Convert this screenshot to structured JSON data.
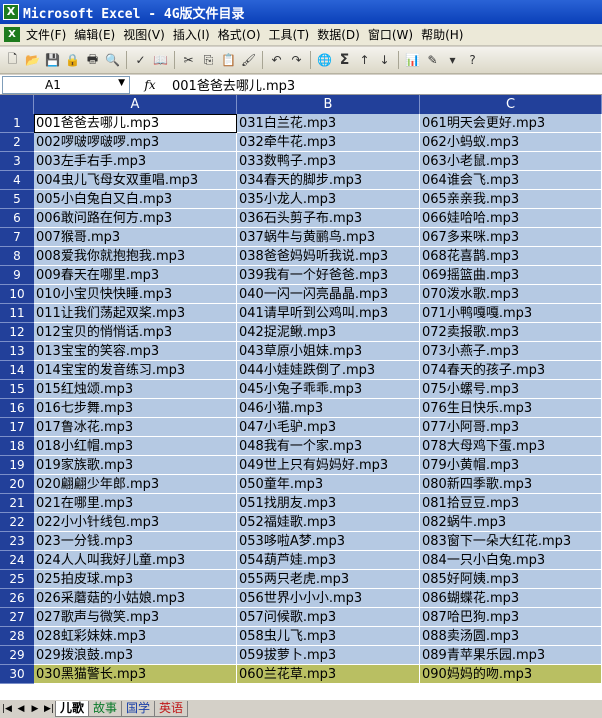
{
  "window": {
    "title": "Microsoft Excel - 4G版文件目录",
    "app_icon": "X"
  },
  "menu": [
    "文件(F)",
    "编辑(E)",
    "视图(V)",
    "插入(I)",
    "格式(O)",
    "工具(T)",
    "数据(D)",
    "窗口(W)",
    "帮助(H)"
  ],
  "toolbar": {
    "sum_symbol": "Σ",
    "zoom": "▾"
  },
  "formula_bar": {
    "name_box": "A1",
    "fx": "fx",
    "content": "001爸爸去哪儿.mp3"
  },
  "columns": [
    "A",
    "B",
    "C"
  ],
  "rows": [
    {
      "n": "1",
      "a": "001爸爸去哪儿.mp3",
      "b": "031白兰花.mp3",
      "c": "061明天会更好.mp3"
    },
    {
      "n": "2",
      "a": "002啰啵啰啵啰.mp3",
      "b": "032牵牛花.mp3",
      "c": "062小蚂蚁.mp3"
    },
    {
      "n": "3",
      "a": "003左手右手.mp3",
      "b": "033数鸭子.mp3",
      "c": "063小老鼠.mp3"
    },
    {
      "n": "4",
      "a": "004虫儿飞母女双重唱.mp3",
      "b": "034春天的脚步.mp3",
      "c": "064谁会飞.mp3"
    },
    {
      "n": "5",
      "a": "005小白兔白又白.mp3",
      "b": "035小龙人.mp3",
      "c": "065亲亲我.mp3"
    },
    {
      "n": "6",
      "a": "006敢问路在何方.mp3",
      "b": "036石头剪子布.mp3",
      "c": "066娃哈哈.mp3"
    },
    {
      "n": "7",
      "a": "007猴哥.mp3",
      "b": "037蜗牛与黄鹂鸟.mp3",
      "c": "067多来咪.mp3"
    },
    {
      "n": "8",
      "a": "008爱我你就抱抱我.mp3",
      "b": "038爸爸妈妈听我说.mp3",
      "c": "068花喜鹊.mp3"
    },
    {
      "n": "9",
      "a": "009春天在哪里.mp3",
      "b": "039我有一个好爸爸.mp3",
      "c": "069摇篮曲.mp3"
    },
    {
      "n": "10",
      "a": "010小宝贝快快睡.mp3",
      "b": "040一闪一闪亮晶晶.mp3",
      "c": "070泼水歌.mp3"
    },
    {
      "n": "11",
      "a": "011让我们荡起双桨.mp3",
      "b": "041请早听到公鸡叫.mp3",
      "c": "071小鸭嘎嘎.mp3"
    },
    {
      "n": "12",
      "a": "012宝贝的悄悄话.mp3",
      "b": "042捉泥鳅.mp3",
      "c": "072卖报歌.mp3"
    },
    {
      "n": "13",
      "a": "013宝宝的笑容.mp3",
      "b": "043草原小姐妹.mp3",
      "c": "073小燕子.mp3"
    },
    {
      "n": "14",
      "a": "014宝宝的发音练习.mp3",
      "b": "044小娃娃跌倒了.mp3",
      "c": "074春天的孩子.mp3"
    },
    {
      "n": "15",
      "a": "015红烛颂.mp3",
      "b": "045小兔子乖乖.mp3",
      "c": "075小螺号.mp3"
    },
    {
      "n": "16",
      "a": "016七步舞.mp3",
      "b": "046小猫.mp3",
      "c": "076生日快乐.mp3"
    },
    {
      "n": "17",
      "a": "017鲁冰花.mp3",
      "b": "047小毛驴.mp3",
      "c": "077小阿哥.mp3"
    },
    {
      "n": "18",
      "a": "018小红帽.mp3",
      "b": "048我有一个家.mp3",
      "c": "078大母鸡下蛋.mp3"
    },
    {
      "n": "19",
      "a": "019家族歌.mp3",
      "b": "049世上只有妈妈好.mp3",
      "c": "079小黄帽.mp3"
    },
    {
      "n": "20",
      "a": "020翩翩少年郎.mp3",
      "b": "050童年.mp3",
      "c": "080新四季歌.mp3"
    },
    {
      "n": "21",
      "a": "021在哪里.mp3",
      "b": "051找朋友.mp3",
      "c": "081拾豆豆.mp3"
    },
    {
      "n": "22",
      "a": "022小小针线包.mp3",
      "b": "052福娃歌.mp3",
      "c": "082蜗牛.mp3"
    },
    {
      "n": "23",
      "a": "023一分钱.mp3",
      "b": "053哆啦A梦.mp3",
      "c": "083窗下一朵大红花.mp3"
    },
    {
      "n": "24",
      "a": "024人人叫我好儿童.mp3",
      "b": "054葫芦娃.mp3",
      "c": "084一只小白兔.mp3"
    },
    {
      "n": "25",
      "a": "025拍皮球.mp3",
      "b": "055两只老虎.mp3",
      "c": "085好阿姨.mp3"
    },
    {
      "n": "26",
      "a": "026采蘑菇的小姑娘.mp3",
      "b": "056世界小小小.mp3",
      "c": "086蝴蝶花.mp3"
    },
    {
      "n": "27",
      "a": "027歌声与微笑.mp3",
      "b": "057问候歌.mp3",
      "c": "087哈巴狗.mp3"
    },
    {
      "n": "28",
      "a": "028虹彩妹妹.mp3",
      "b": "058虫儿飞.mp3",
      "c": "088卖汤圆.mp3"
    },
    {
      "n": "29",
      "a": "029拨浪鼓.mp3",
      "b": "059拔萝卜.mp3",
      "c": "089青苹果乐园.mp3"
    },
    {
      "n": "30",
      "a": "030黑猫警长.mp3",
      "b": "060兰花草.mp3",
      "c": "090妈妈的吻.mp3"
    }
  ],
  "sheets": [
    "儿歌",
    "故事",
    "国学",
    "英语"
  ],
  "colors": {
    "header_bg": "#22409a",
    "cell_bg": "#b5c9e3",
    "row30_bg": "#b9bf62",
    "title_bg": "#0a3fb8"
  }
}
